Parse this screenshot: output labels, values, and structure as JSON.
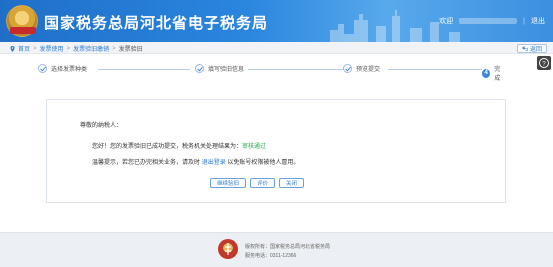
{
  "header": {
    "title": "国家税务总局河北省电子税务局",
    "welcome": "欢迎",
    "logout": "退出"
  },
  "breadcrumb": {
    "items": [
      "首页",
      "发票使用",
      "发票验旧缴销",
      "发票验旧"
    ],
    "back_label": "返回"
  },
  "steps": [
    {
      "label": "选择发票种类",
      "state": "done"
    },
    {
      "label": "填写验旧信息",
      "state": "done"
    },
    {
      "label": "预览提交",
      "state": "done"
    },
    {
      "label": "完成",
      "state": "active",
      "number": "4"
    }
  ],
  "result": {
    "greeting": "尊敬的纳税人：",
    "message_prefix": "您好！您的发票验旧已成功提交，税务机关处理结果为：",
    "status": "审核通过",
    "reminder_prefix": "温馨提示，若您已办完相关业务，请及时",
    "exit_link": "退出登录",
    "reminder_suffix": "以免账号权限被他人冒用。"
  },
  "buttons": {
    "continue": "继续验旧",
    "rate": "评价",
    "close": "关闭"
  },
  "footer": {
    "copyright": "版权所有：国家税务总局河北省税务局",
    "hotline": "服务电话：0311-12366"
  },
  "colors": {
    "header_blue": "#2b86de",
    "link_blue": "#2a7ad1",
    "success_green": "#2fa84f"
  }
}
